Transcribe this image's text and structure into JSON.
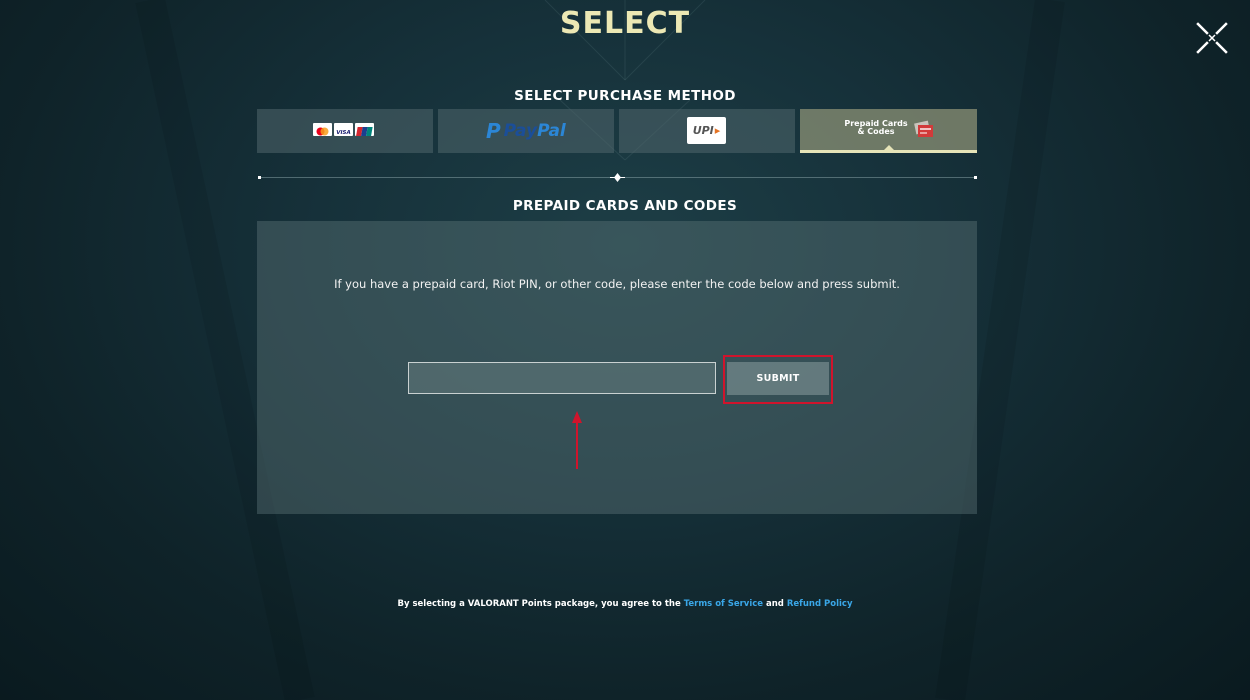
{
  "page": {
    "title": "SELECT"
  },
  "purchase_methods": {
    "label": "SELECT PURCHASE METHOD",
    "tabs": [
      {
        "id": "cards",
        "icons": [
          "mastercard-icon",
          "visa-icon",
          "unionpay-icon"
        ],
        "visa_text": "VISA",
        "active": false
      },
      {
        "id": "paypal",
        "text_pay": "Pay",
        "text_pal": "Pal",
        "mark": "P",
        "active": false
      },
      {
        "id": "upi",
        "text": "UPI",
        "active": false
      },
      {
        "id": "prepaid",
        "label_line1": "Prepaid Cards",
        "label_line2": "& Codes",
        "icon": "gift-cards-icon",
        "active": true
      }
    ]
  },
  "prepaid": {
    "section_label": "PREPAID CARDS AND CODES",
    "instructions": "If you have a prepaid card, Riot PIN, or other code, please enter the code below and press submit.",
    "code_input": {
      "value": "",
      "placeholder": ""
    },
    "submit_label": "SUBMIT"
  },
  "footer": {
    "prefix": "By selecting a VALORANT Points package, you agree to the",
    "terms_link": "Terms of Service",
    "and": "and",
    "refund_link": "Refund Policy"
  },
  "colors": {
    "title": "#ece8b4",
    "active_tab_accent": "#e6e4b8",
    "link": "#3aa7e8",
    "highlight": "#d0142c",
    "annotation_arrow": "#d0142c"
  }
}
